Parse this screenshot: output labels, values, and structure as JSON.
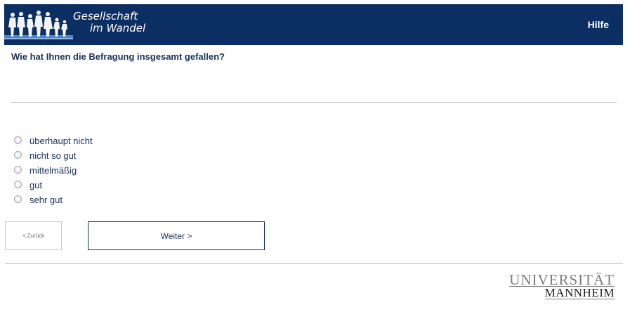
{
  "header": {
    "logo_line1": "Gesellschaft",
    "logo_line2": "im Wandel",
    "help_label": "Hilfe",
    "background_color": "#0b2e63"
  },
  "question": {
    "text": "Wie hat Ihnen die Befragung insgesamt gefallen?"
  },
  "options": [
    {
      "label": "überhaupt nicht"
    },
    {
      "label": "nicht so gut"
    },
    {
      "label": "mittelmäßig"
    },
    {
      "label": "gut"
    },
    {
      "label": "sehr gut"
    }
  ],
  "navigation": {
    "back_label": "< Zurück",
    "next_label": "Weiter >"
  },
  "footer": {
    "university_line1": "UNIVERSITÄT",
    "university_line2": "MANNHEIM"
  }
}
